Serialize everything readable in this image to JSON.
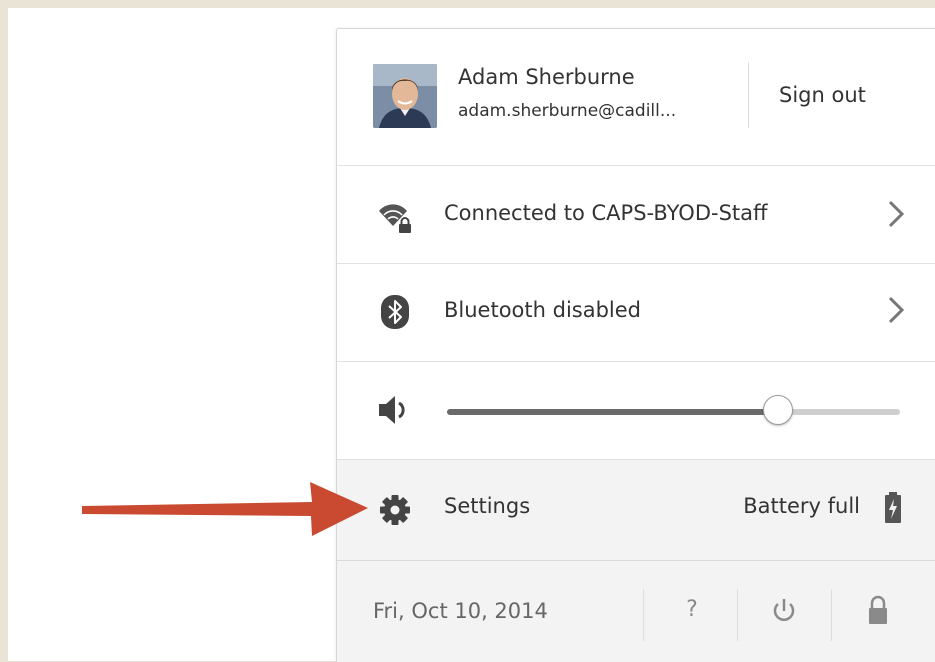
{
  "user": {
    "name": "Adam Sherburne",
    "email": "adam.sherburne@cadill...",
    "sign_out_label": "Sign out"
  },
  "network": {
    "label": "Connected to CAPS-BYOD-Staff",
    "icon": "wifi-lock-icon"
  },
  "bluetooth": {
    "label": "Bluetooth disabled",
    "icon": "bluetooth-icon"
  },
  "volume": {
    "level": 0.73,
    "icon": "speaker-icon"
  },
  "settings": {
    "label": "Settings",
    "icon": "gear-icon",
    "battery_label": "Battery full",
    "battery_icon": "battery-charging-icon"
  },
  "footer": {
    "date": "Fri, Oct 10, 2014",
    "help_label": "?",
    "power_icon": "power-icon",
    "lock_icon": "lock-icon"
  },
  "colors": {
    "annotation_arrow": "#c94a30",
    "page_background": "#e9e4d6"
  }
}
